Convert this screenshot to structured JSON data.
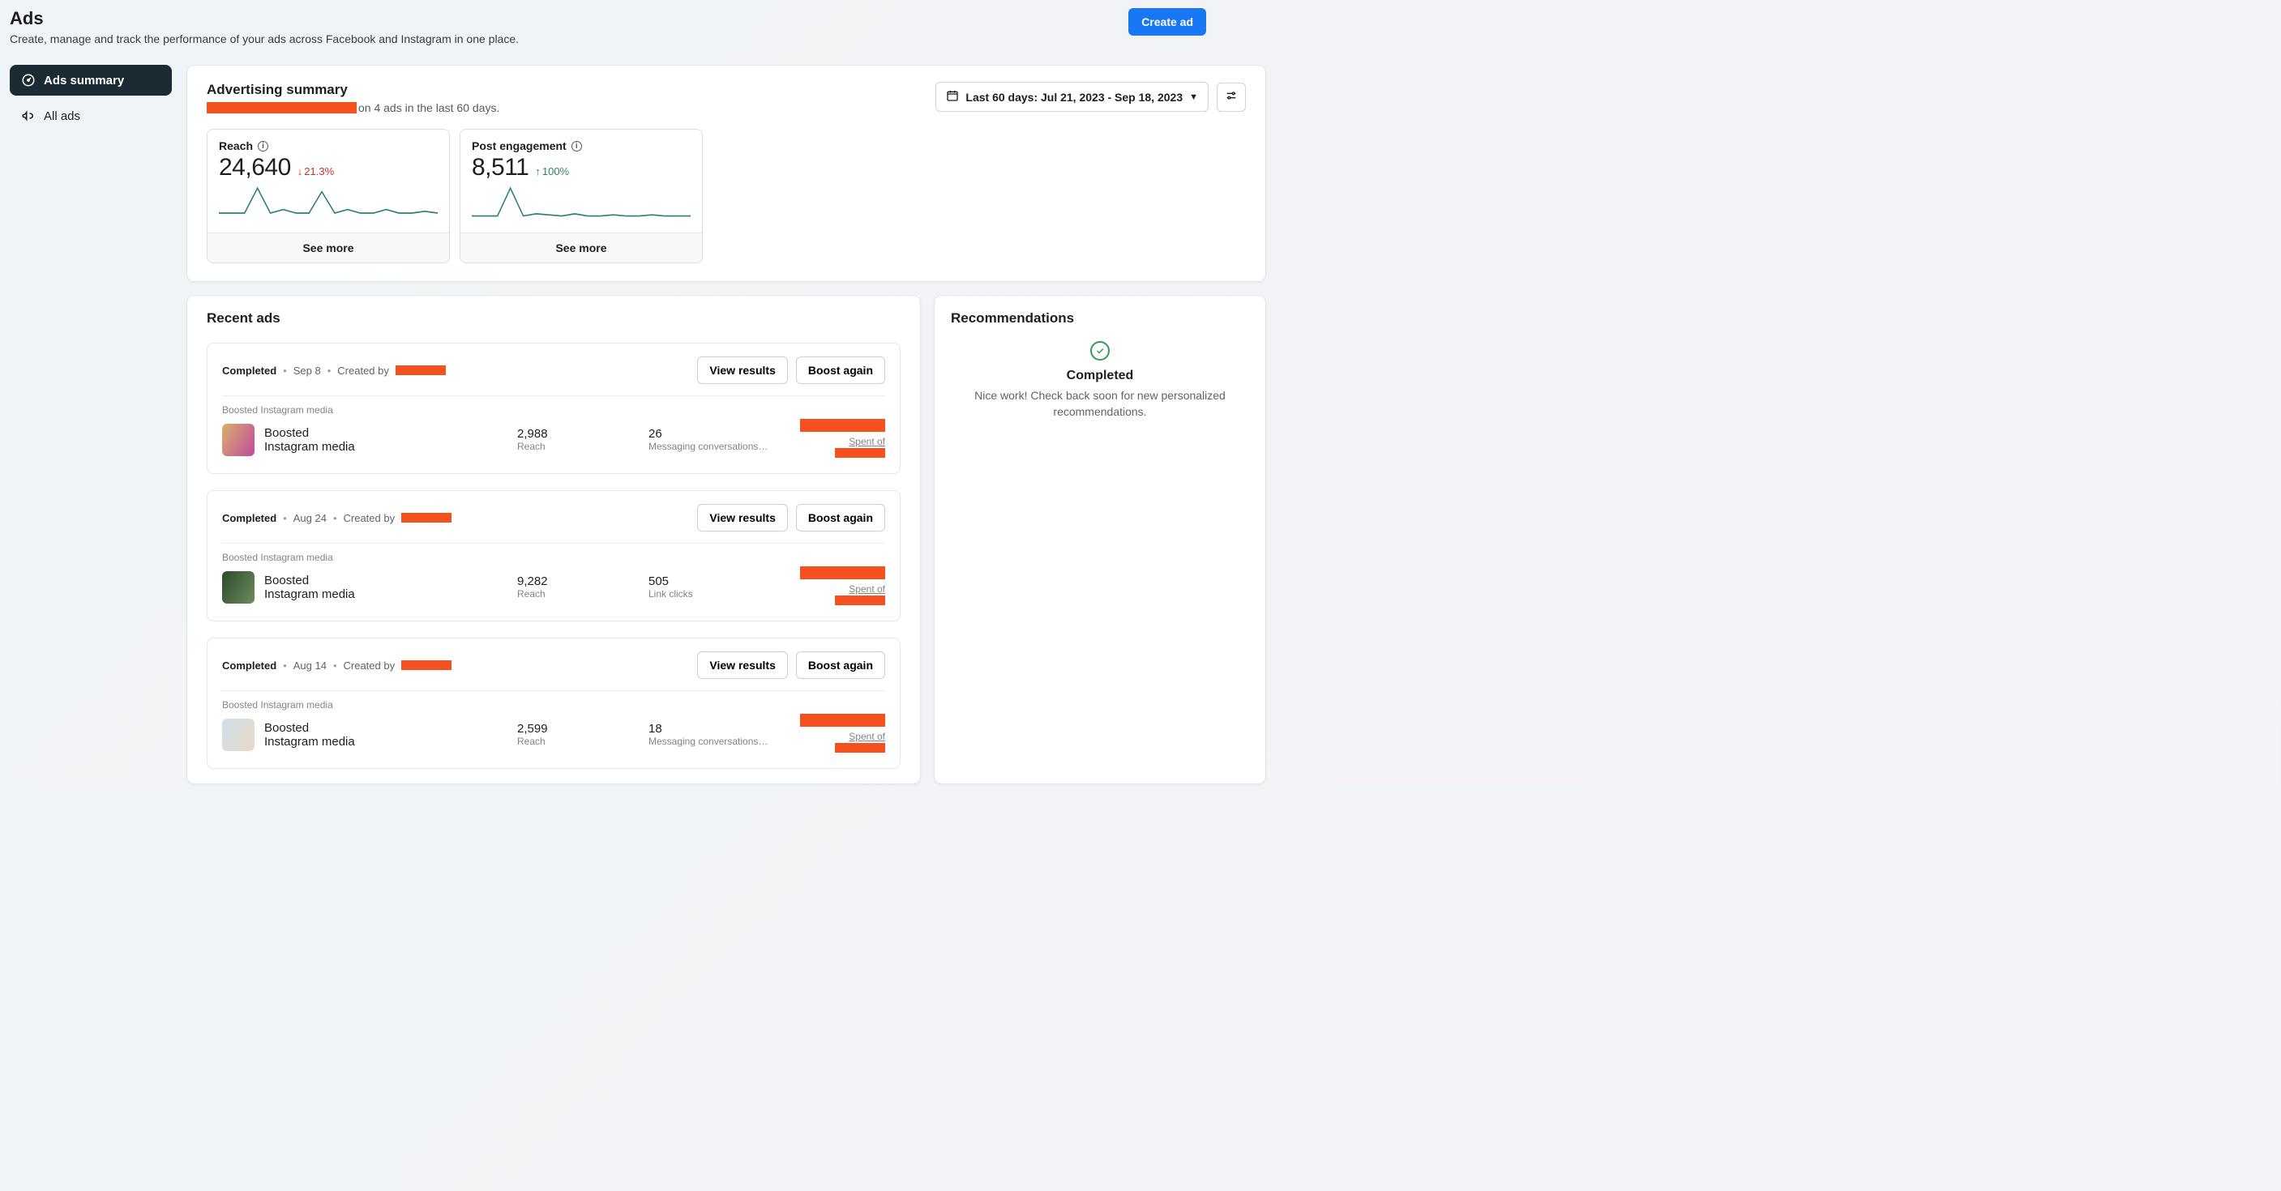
{
  "header": {
    "title": "Ads",
    "subtitle": "Create, manage and track the performance of your ads across Facebook and Instagram in one place.",
    "create_ad_label": "Create ad"
  },
  "sidebar": {
    "items": [
      {
        "label": "Ads summary",
        "icon": "gauge-icon",
        "active": true
      },
      {
        "label": "All ads",
        "icon": "megaphone-icon",
        "active": false
      }
    ]
  },
  "summary": {
    "title": "Advertising summary",
    "subtitle_suffix": " on 4 ads in the last 60 days.",
    "date_range_label": "Last 60 days: Jul 21, 2023 - Sep 18, 2023",
    "metrics": [
      {
        "label": "Reach",
        "value": "24,640",
        "delta_direction": "down",
        "delta_text": "21.3%",
        "see_more_label": "See more",
        "spark": [
          4,
          4,
          4,
          18,
          4,
          6,
          4,
          4,
          16,
          4,
          6,
          4,
          4,
          6,
          4,
          4,
          5,
          4
        ]
      },
      {
        "label": "Post engagement",
        "value": "8,511",
        "delta_direction": "up",
        "delta_text": "100%",
        "see_more_label": "See more",
        "spark": [
          4,
          4,
          4,
          30,
          4,
          6,
          5,
          4,
          6,
          4,
          4,
          5,
          4,
          4,
          5,
          4,
          4,
          4
        ]
      }
    ]
  },
  "recent": {
    "title": "Recent ads",
    "view_results_label": "View results",
    "boost_again_label": "Boost again",
    "status_label": "Completed",
    "created_by_label": "Created by",
    "boosted_label": "Boosted Instagram media",
    "ad_line1": "Boosted",
    "ad_line2": "Instagram media",
    "reach_label": "Reach",
    "spent_of_label": "Spent of",
    "ads": [
      {
        "date": "Sep 8",
        "thumb_class": "t1",
        "reach": "2,988",
        "secondary_val": "26",
        "secondary_label": "Messaging conversations…"
      },
      {
        "date": "Aug 24",
        "thumb_class": "t2",
        "reach": "9,282",
        "secondary_val": "505",
        "secondary_label": "Link clicks"
      },
      {
        "date": "Aug 14",
        "thumb_class": "t3",
        "reach": "2,599",
        "secondary_val": "18",
        "secondary_label": "Messaging conversations…"
      }
    ]
  },
  "recommendations": {
    "title": "Recommendations",
    "status": "Completed",
    "text": "Nice work! Check back soon for new personalized recommendations."
  }
}
